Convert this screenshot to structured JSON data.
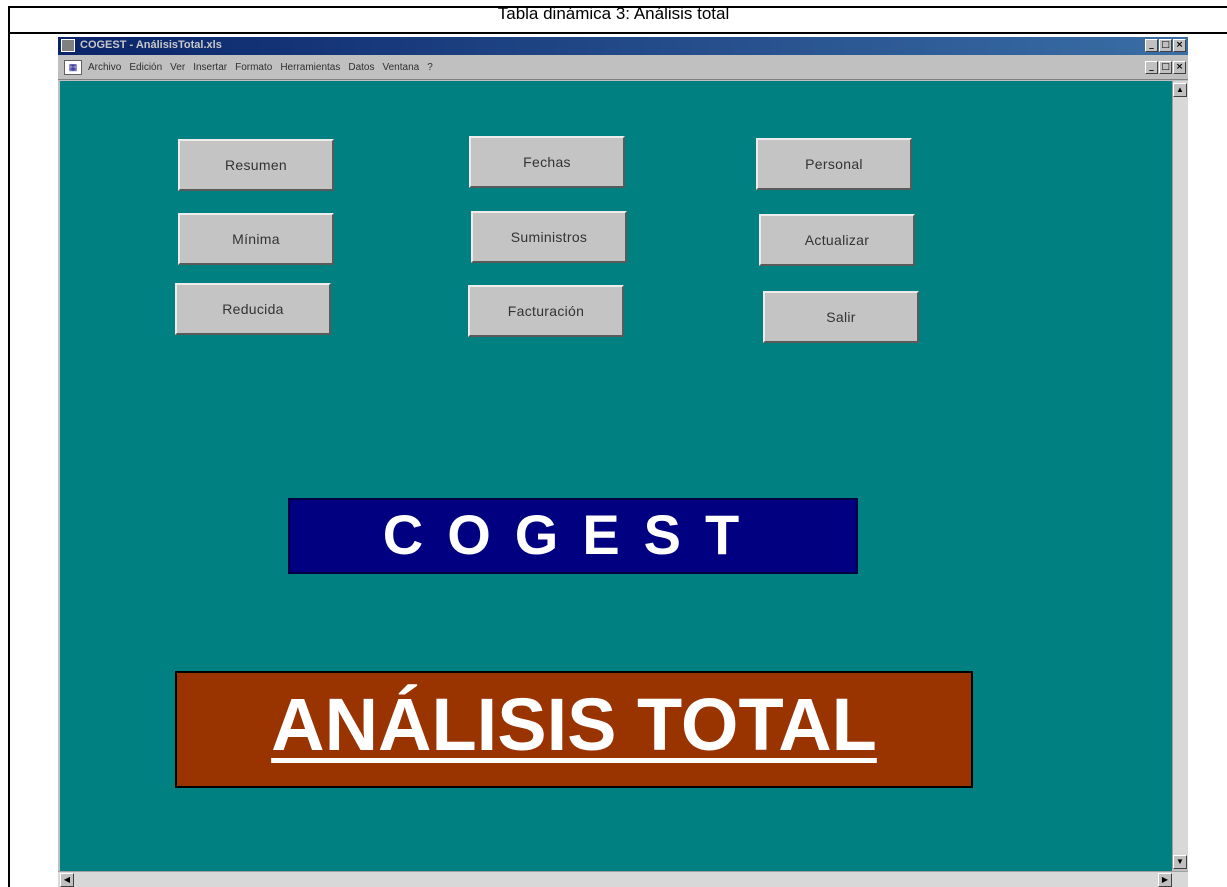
{
  "caption": "Tabla dinámica 3: Análisis total",
  "window": {
    "title": "COGEST - AnálisisTotal.xls",
    "controls": {
      "minimize": "_",
      "maximize": "□",
      "close": "×"
    }
  },
  "menubar": {
    "items": [
      "Archivo",
      "Edición",
      "Ver",
      "Insertar",
      "Formato",
      "Herramientas",
      "Datos",
      "Ventana",
      "?"
    ]
  },
  "buttons": {
    "resumen": "Resumen",
    "fechas": "Fechas",
    "personal": "Personal",
    "minima": "Mínima",
    "suministros": "Suministros",
    "actualizar": "Actualizar",
    "reducida": "Reducida",
    "facturacion": "Facturación",
    "salir": "Salir"
  },
  "banners": {
    "cogest": "COGEST",
    "analisis": "ANÁLISIS TOTAL"
  },
  "colors": {
    "background": "#008080",
    "cogest_banner": "#000080",
    "analisis_banner": "#993300"
  }
}
